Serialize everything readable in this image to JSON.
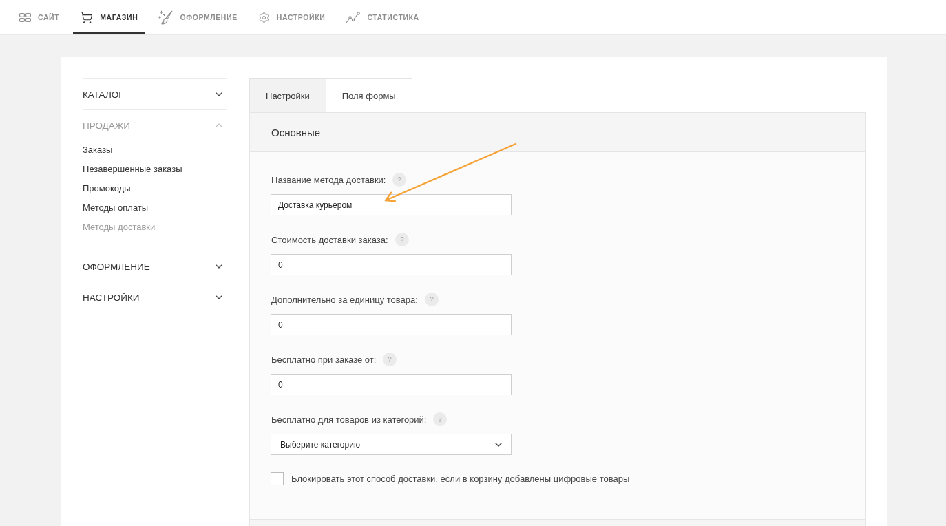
{
  "nav": [
    {
      "label": "САЙТ",
      "selected": false
    },
    {
      "label": "МАГАЗИН",
      "selected": true
    },
    {
      "label": "ОФОРМЛЕНИЕ",
      "selected": false
    },
    {
      "label": "НАСТРОЙКИ",
      "selected": false
    },
    {
      "label": "СТАТИСТИКА",
      "selected": false
    }
  ],
  "sidebar": {
    "sections": [
      {
        "title": "КАТАЛОГ",
        "expanded": false
      },
      {
        "title": "ПРОДАЖИ",
        "expanded": true,
        "items": [
          {
            "label": "Заказы",
            "selected": false
          },
          {
            "label": "Незавершенные заказы",
            "selected": false
          },
          {
            "label": "Промокоды",
            "selected": false
          },
          {
            "label": "Методы оплаты",
            "selected": false
          },
          {
            "label": "Методы доставки",
            "selected": true
          }
        ]
      },
      {
        "title": "ОФОРМЛЕНИЕ",
        "expanded": false
      },
      {
        "title": "НАСТРОЙКИ",
        "expanded": false
      }
    ]
  },
  "tabs": [
    {
      "label": "Настройки",
      "selected": true
    },
    {
      "label": "Поля формы",
      "selected": false
    }
  ],
  "section": {
    "title": "Основные",
    "fields": [
      {
        "kind": "text",
        "label": "Название метода доставки:",
        "value": "Доставка курьером"
      },
      {
        "kind": "text",
        "label": "Стоимость доставки заказа:",
        "value": "0"
      },
      {
        "kind": "text",
        "label": "Дополнительно за единицу товара:",
        "value": "0"
      },
      {
        "kind": "text",
        "label": "Бесплатно при заказе от:",
        "value": "0"
      },
      {
        "kind": "select",
        "label": "Бесплатно для товаров из категорий:",
        "value": "Выберите категорию"
      }
    ],
    "checkbox": {
      "label": "Блокировать этот способ доставки, если в корзину добавлены цифровые товары",
      "checked": false
    }
  }
}
